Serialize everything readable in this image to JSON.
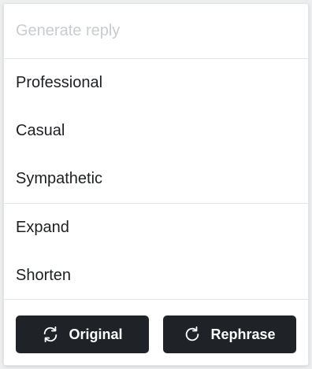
{
  "input": {
    "placeholder": "Generate reply",
    "value": ""
  },
  "tone_options": [
    {
      "label": "Professional"
    },
    {
      "label": "Casual"
    },
    {
      "label": "Sympathetic"
    }
  ],
  "length_options": [
    {
      "label": "Expand"
    },
    {
      "label": "Shorten"
    }
  ],
  "buttons": {
    "original": {
      "label": "Original",
      "icon": "swap-refresh-icon"
    },
    "rephrase": {
      "label": "Rephrase",
      "icon": "refresh-icon"
    }
  },
  "colors": {
    "button_bg": "#1f2327",
    "button_text": "#ffffff",
    "placeholder": "#c9ccd0",
    "text": "#1d1f23"
  }
}
